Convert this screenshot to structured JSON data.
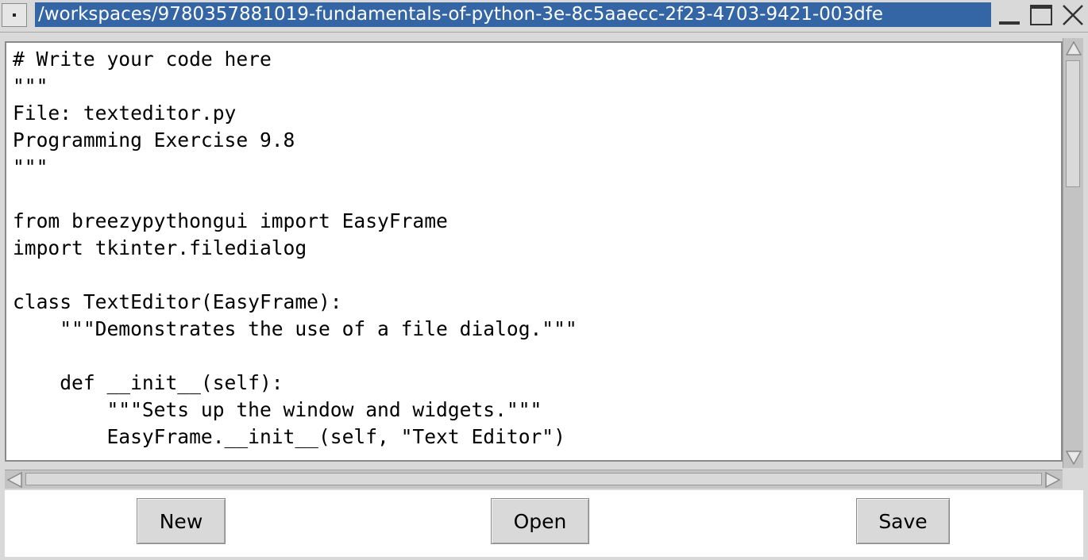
{
  "window": {
    "title": "/workspaces/9780357881019-fundamentals-of-python-3e-8c5aaecc-2f23-4703-9421-003dfe",
    "menu_icon": "window-menu-icon",
    "minimize_icon": "minimize-icon",
    "maximize_icon": "maximize-icon",
    "close_icon": "close-icon"
  },
  "editor": {
    "lines": [
      "# Write your code here",
      "\"\"\"",
      "File: texteditor.py",
      "Programming Exercise 9.8",
      "\"\"\"",
      "",
      "from breezypythongui import EasyFrame",
      "import tkinter.filedialog",
      "",
      "class TextEditor(EasyFrame):",
      "    \"\"\"Demonstrates the use of a file dialog.\"\"\"",
      "",
      "    def __init__(self):",
      "        \"\"\"Sets up the window and widgets.\"\"\"",
      "        EasyFrame.__init__(self, \"Text Editor\")"
    ]
  },
  "buttons": {
    "new_label": "New",
    "open_label": "Open",
    "save_label": "Save"
  },
  "colors": {
    "title_bg": "#3465a4",
    "window_bg": "#d9d9d9",
    "editor_bg": "#ffffff"
  }
}
